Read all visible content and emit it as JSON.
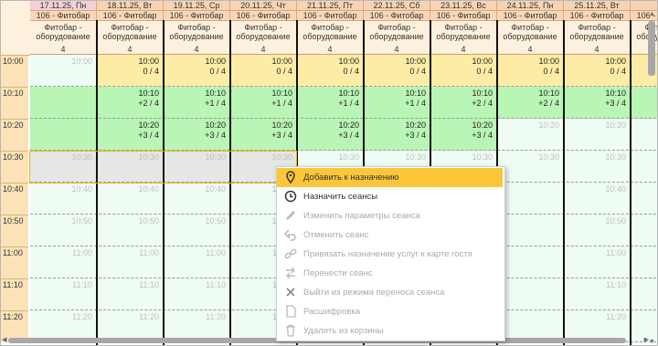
{
  "dates": [
    {
      "label": "17.11.25, Пн",
      "selected": true
    },
    {
      "label": "18.11.25, Вт"
    },
    {
      "label": "19.11.25, Ср"
    },
    {
      "label": "20.11.25, Чт"
    },
    {
      "label": "21.11.25, Пт"
    },
    {
      "label": "22.11.25, Сб"
    },
    {
      "label": "23.11.25, Вс"
    },
    {
      "label": "24.11.25, Пн"
    },
    {
      "label": "25.11.25, Вт"
    },
    {
      "label": "26"
    }
  ],
  "room": "106 - Фитобар",
  "service_line1": "Фитобар -",
  "service_line2": "оборудование",
  "capacity": "4",
  "times": [
    "10:00",
    "10:10",
    "10:20",
    "10:30",
    "10:40",
    "10:50",
    "11:00",
    "11:10",
    "11:20"
  ],
  "rows": [
    {
      "cells": [
        {
          "t": "10:00",
          "s": "",
          "k": "free"
        },
        {
          "t": "10:00",
          "s": "0 / 4",
          "k": "yel"
        },
        {
          "t": "10:00",
          "s": "0 / 4",
          "k": "yel"
        },
        {
          "t": "10:00",
          "s": "0 / 4",
          "k": "yel"
        },
        {
          "t": "10:00",
          "s": "0 / 4",
          "k": "yel"
        },
        {
          "t": "10:00",
          "s": "0 / 4",
          "k": "yel"
        },
        {
          "t": "10:00",
          "s": "0 / 4",
          "k": "yel"
        },
        {
          "t": "10:00",
          "s": "0 / 4",
          "k": "yel"
        },
        {
          "t": "10:00",
          "s": "0 / 4",
          "k": "yel"
        },
        {
          "t": "",
          "s": "",
          "k": "yel"
        }
      ]
    },
    {
      "cells": [
        {
          "t": "",
          "s": "",
          "k": "grn"
        },
        {
          "t": "10:10",
          "s": "+2 / 4",
          "k": "grn"
        },
        {
          "t": "10:10",
          "s": "+1 / 4",
          "k": "grn"
        },
        {
          "t": "10:10",
          "s": "+1 / 4",
          "k": "grn"
        },
        {
          "t": "10:10",
          "s": "+1 / 4",
          "k": "grn"
        },
        {
          "t": "10:10",
          "s": "+1 / 4",
          "k": "grn"
        },
        {
          "t": "10:10",
          "s": "+2 / 4",
          "k": "grn"
        },
        {
          "t": "10:10",
          "s": "+2 / 4",
          "k": "grn"
        },
        {
          "t": "10:10",
          "s": "+3 / 4",
          "k": "grn"
        },
        {
          "t": "",
          "s": "",
          "k": "grn"
        }
      ]
    },
    {
      "cells": [
        {
          "t": "",
          "s": "",
          "k": "grn"
        },
        {
          "t": "10:20",
          "s": "+3 / 4",
          "k": "grn"
        },
        {
          "t": "10:20",
          "s": "+3 / 4",
          "k": "grn"
        },
        {
          "t": "10:20",
          "s": "+3 / 4",
          "k": "grn"
        },
        {
          "t": "10:20",
          "s": "+3 / 4",
          "k": "grn"
        },
        {
          "t": "10:20",
          "s": "+3 / 4",
          "k": "grn"
        },
        {
          "t": "10:20",
          "s": "+3 / 4",
          "k": "grn"
        },
        {
          "t": "10:20",
          "s": "",
          "k": "free"
        },
        {
          "t": "10:20",
          "s": "",
          "k": "free"
        },
        {
          "t": "",
          "s": "",
          "k": "free"
        }
      ]
    },
    {
      "cells": [
        {
          "t": "10:30",
          "s": "",
          "k": "grey"
        },
        {
          "t": "10:30",
          "s": "",
          "k": "grey"
        },
        {
          "t": "10:30",
          "s": "",
          "k": "grey"
        },
        {
          "t": "10:30",
          "s": "",
          "k": "grey"
        },
        {
          "t": "10:30",
          "s": "",
          "k": "free"
        },
        {
          "t": "10:30",
          "s": "",
          "k": "free"
        },
        {
          "t": "10:30",
          "s": "",
          "k": "free"
        },
        {
          "t": "10:30",
          "s": "",
          "k": "free"
        },
        {
          "t": "10:30",
          "s": "",
          "k": "free"
        },
        {
          "t": "",
          "s": "",
          "k": "free"
        }
      ]
    },
    {
      "cells": [
        {
          "t": "10:40",
          "s": "",
          "k": "free"
        },
        {
          "t": "10:40",
          "s": "",
          "k": "free"
        },
        {
          "t": "10:40",
          "s": "",
          "k": "free"
        },
        {
          "t": "10:40",
          "s": "",
          "k": "free"
        },
        {
          "t": "",
          "s": "",
          "k": "free"
        },
        {
          "t": "",
          "s": "",
          "k": "free"
        },
        {
          "t": "",
          "s": "",
          "k": "free"
        },
        {
          "t": "",
          "s": "",
          "k": "free"
        },
        {
          "t": "10:40",
          "s": "",
          "k": "free"
        },
        {
          "t": "",
          "s": "",
          "k": "free"
        }
      ]
    },
    {
      "cells": [
        {
          "t": "10:50",
          "s": "",
          "k": "free"
        },
        {
          "t": "10:50",
          "s": "",
          "k": "free"
        },
        {
          "t": "10:50",
          "s": "",
          "k": "free"
        },
        {
          "t": "10:50",
          "s": "",
          "k": "free"
        },
        {
          "t": "",
          "s": "",
          "k": "free"
        },
        {
          "t": "",
          "s": "",
          "k": "free"
        },
        {
          "t": "",
          "s": "",
          "k": "free"
        },
        {
          "t": "",
          "s": "",
          "k": "free"
        },
        {
          "t": "10:50",
          "s": "",
          "k": "free"
        },
        {
          "t": "",
          "s": "",
          "k": "free"
        }
      ]
    },
    {
      "cells": [
        {
          "t": "11:00",
          "s": "",
          "k": "free"
        },
        {
          "t": "11:00",
          "s": "",
          "k": "free"
        },
        {
          "t": "11:00",
          "s": "",
          "k": "free"
        },
        {
          "t": "11:00",
          "s": "",
          "k": "free"
        },
        {
          "t": "",
          "s": "",
          "k": "free"
        },
        {
          "t": "",
          "s": "",
          "k": "free"
        },
        {
          "t": "",
          "s": "",
          "k": "free"
        },
        {
          "t": "",
          "s": "",
          "k": "free"
        },
        {
          "t": "11:00",
          "s": "",
          "k": "free"
        },
        {
          "t": "",
          "s": "",
          "k": "free"
        }
      ]
    },
    {
      "cells": [
        {
          "t": "11:10",
          "s": "",
          "k": "free"
        },
        {
          "t": "11:10",
          "s": "",
          "k": "free"
        },
        {
          "t": "11:10",
          "s": "",
          "k": "free"
        },
        {
          "t": "11:10",
          "s": "",
          "k": "free"
        },
        {
          "t": "",
          "s": "",
          "k": "free"
        },
        {
          "t": "",
          "s": "",
          "k": "free"
        },
        {
          "t": "",
          "s": "",
          "k": "free"
        },
        {
          "t": "",
          "s": "",
          "k": "free"
        },
        {
          "t": "11:10",
          "s": "",
          "k": "free"
        },
        {
          "t": "",
          "s": "",
          "k": "free"
        }
      ]
    },
    {
      "cells": [
        {
          "t": "11:20",
          "s": "",
          "k": "free"
        },
        {
          "t": "11:20",
          "s": "",
          "k": "free"
        },
        {
          "t": "11:20",
          "s": "",
          "k": "free"
        },
        {
          "t": "11:20",
          "s": "",
          "k": "free"
        },
        {
          "t": "",
          "s": "",
          "k": "free"
        },
        {
          "t": "",
          "s": "",
          "k": "free"
        },
        {
          "t": "",
          "s": "",
          "k": "free"
        },
        {
          "t": "",
          "s": "",
          "k": "free"
        },
        {
          "t": "11:20",
          "s": "",
          "k": "free"
        },
        {
          "t": "",
          "s": "",
          "k": "free"
        }
      ]
    }
  ],
  "context_menu": {
    "items": [
      {
        "label": "Добавить к назначению",
        "icon": "pin-icon",
        "enabled": true,
        "highlighted": true
      },
      {
        "label": "Назначить сеансы",
        "icon": "clock-icon",
        "enabled": true
      },
      {
        "label": "Изменить параметры сеанса",
        "icon": "pencil-icon",
        "enabled": false
      },
      {
        "label": "Отменить сеанс",
        "icon": "undo-icon",
        "enabled": false
      },
      {
        "label": "Привязать назначение услуг к карте гостя",
        "icon": "link-icon",
        "enabled": false
      },
      {
        "label": "Перенести сеанс",
        "icon": "swap-arrows-icon",
        "enabled": false
      },
      {
        "label": "Выйти из режима переноса сеанса",
        "icon": "close-icon",
        "enabled": false
      },
      {
        "label": "Расшифровка",
        "icon": "document-icon",
        "enabled": false
      },
      {
        "label": "Удалить из корзины",
        "icon": "trash-icon",
        "enabled": false
      }
    ]
  },
  "colors": {
    "booked": "#fdeca6",
    "available": "#b9f5b4",
    "free": "#eefcf4",
    "menu_highlight": "#fcc63a"
  }
}
